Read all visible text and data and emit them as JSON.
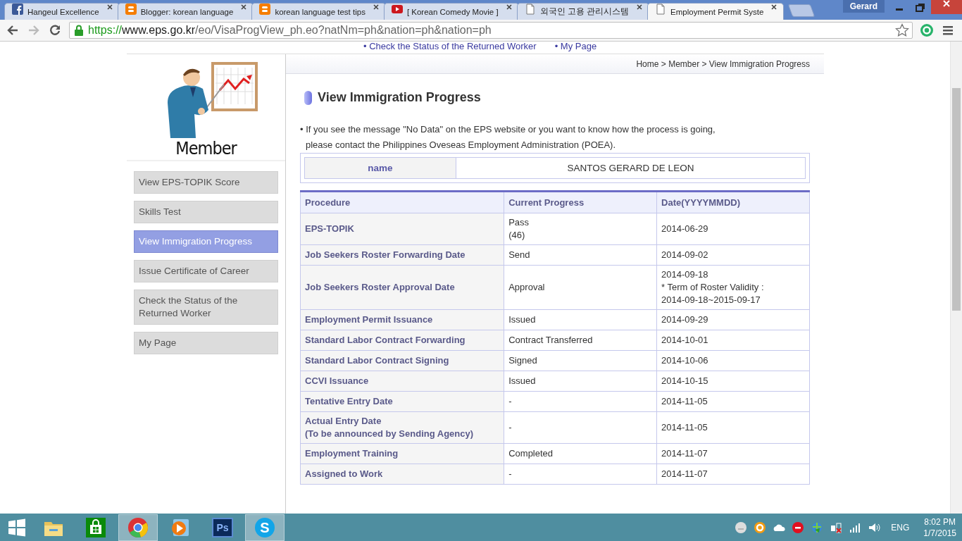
{
  "browser": {
    "tabs": [
      {
        "title": "Hangeul Excellence",
        "kind": "facebook",
        "selected": false
      },
      {
        "title": "Blogger: korean language",
        "kind": "blogger",
        "selected": false
      },
      {
        "title": "korean language test tips",
        "kind": "blogger",
        "selected": false
      },
      {
        "title": "[ Korean Comedy Movie ]",
        "kind": "youtube",
        "selected": false
      },
      {
        "title": "외국인 고용 관리시스템",
        "kind": "page",
        "selected": false
      },
      {
        "title": "Employment Permit Syste",
        "kind": "page",
        "selected": true
      }
    ],
    "user": "Gerard",
    "url": {
      "scheme": "https://",
      "host": "www.eps.go.kr",
      "path": "/eo/VisaProgView_ph.eo?natNm=ph&nation=ph&nation=ph"
    }
  },
  "top_nav": [
    "• Check the Status of the Returned Worker",
    "• My Page"
  ],
  "sidebar": {
    "title": "Member",
    "items": [
      {
        "label": "View EPS-TOPIK Score",
        "selected": false
      },
      {
        "label": "Skills Test",
        "selected": false
      },
      {
        "label": "View Immigration Progress",
        "selected": true
      },
      {
        "label": "Issue Certificate of Career",
        "selected": false
      },
      {
        "label": "Check the Status of the Returned Worker",
        "selected": false
      },
      {
        "label": "My Page",
        "selected": false
      }
    ]
  },
  "breadcrumb": [
    "Home",
    "Member",
    "View Immigration Progress"
  ],
  "breadcrumb_separator": ">",
  "heading": "View Immigration Progress",
  "notice": [
    "• If you see the message \"No Data\" on the EPS website or you want to know how the process is going,",
    "please contact the Philippines Oveseas Employment Administration (POEA)."
  ],
  "name_table": {
    "label": "name",
    "value": "SANTOS GERARD DE LEON"
  },
  "table": {
    "columns": [
      "Procedure",
      "Current Progress",
      "Date(YYYYMMDD)"
    ],
    "rows": [
      {
        "procedure": [
          "EPS-TOPIK"
        ],
        "progress": [
          "Pass",
          "(46)"
        ],
        "date": [
          "2014-06-29"
        ]
      },
      {
        "procedure": [
          "Job Seekers Roster Forwarding Date"
        ],
        "progress": [
          "Send"
        ],
        "date": [
          "2014-09-02"
        ]
      },
      {
        "procedure": [
          "Job Seekers Roster Approval Date"
        ],
        "progress": [
          "Approval"
        ],
        "date": [
          "2014-09-18",
          "* Term of Roster Validity :",
          "2014-09-18~2015-09-17"
        ]
      },
      {
        "procedure": [
          "Employment Permit Issuance"
        ],
        "progress": [
          "Issued"
        ],
        "date": [
          "2014-09-29"
        ]
      },
      {
        "procedure": [
          "Standard Labor Contract Forwarding"
        ],
        "progress": [
          "Contract Transferred"
        ],
        "date": [
          "2014-10-01"
        ]
      },
      {
        "procedure": [
          "Standard Labor Contract Signing"
        ],
        "progress": [
          "Signed"
        ],
        "date": [
          "2014-10-06"
        ]
      },
      {
        "procedure": [
          "CCVI Issuance"
        ],
        "progress": [
          "Issued"
        ],
        "date": [
          "2014-10-15"
        ]
      },
      {
        "procedure": [
          "Tentative Entry Date"
        ],
        "progress": [
          "-"
        ],
        "date": [
          "2014-11-05"
        ]
      },
      {
        "procedure": [
          "Actual Entry Date",
          "(To be announced by Sending Agency)"
        ],
        "progress": [
          "-"
        ],
        "date": [
          "2014-11-05"
        ]
      },
      {
        "procedure": [
          "Employment Training"
        ],
        "progress": [
          "Completed"
        ],
        "date": [
          "2014-11-07"
        ]
      },
      {
        "procedure": [
          "Assigned to Work"
        ],
        "progress": [
          "-"
        ],
        "date": [
          "2014-11-07"
        ]
      }
    ]
  },
  "taskbar": {
    "apps": [
      {
        "kind": "explorer",
        "highlighted": false
      },
      {
        "kind": "store",
        "highlighted": false
      },
      {
        "kind": "chrome",
        "highlighted": true
      },
      {
        "kind": "player",
        "highlighted": false
      },
      {
        "kind": "photoshop",
        "label": "Ps",
        "highlighted": false
      },
      {
        "kind": "skype",
        "label": "S",
        "highlighted": true
      }
    ],
    "tray": [
      {
        "kind": "smiley"
      },
      {
        "kind": "ring"
      },
      {
        "kind": "cloud"
      },
      {
        "kind": "stop"
      },
      {
        "kind": "globe"
      },
      {
        "kind": "power"
      },
      {
        "kind": "signal"
      },
      {
        "kind": "volume"
      }
    ],
    "language": "ENG",
    "time": "8:02 PM",
    "date": "1/7/2015"
  }
}
